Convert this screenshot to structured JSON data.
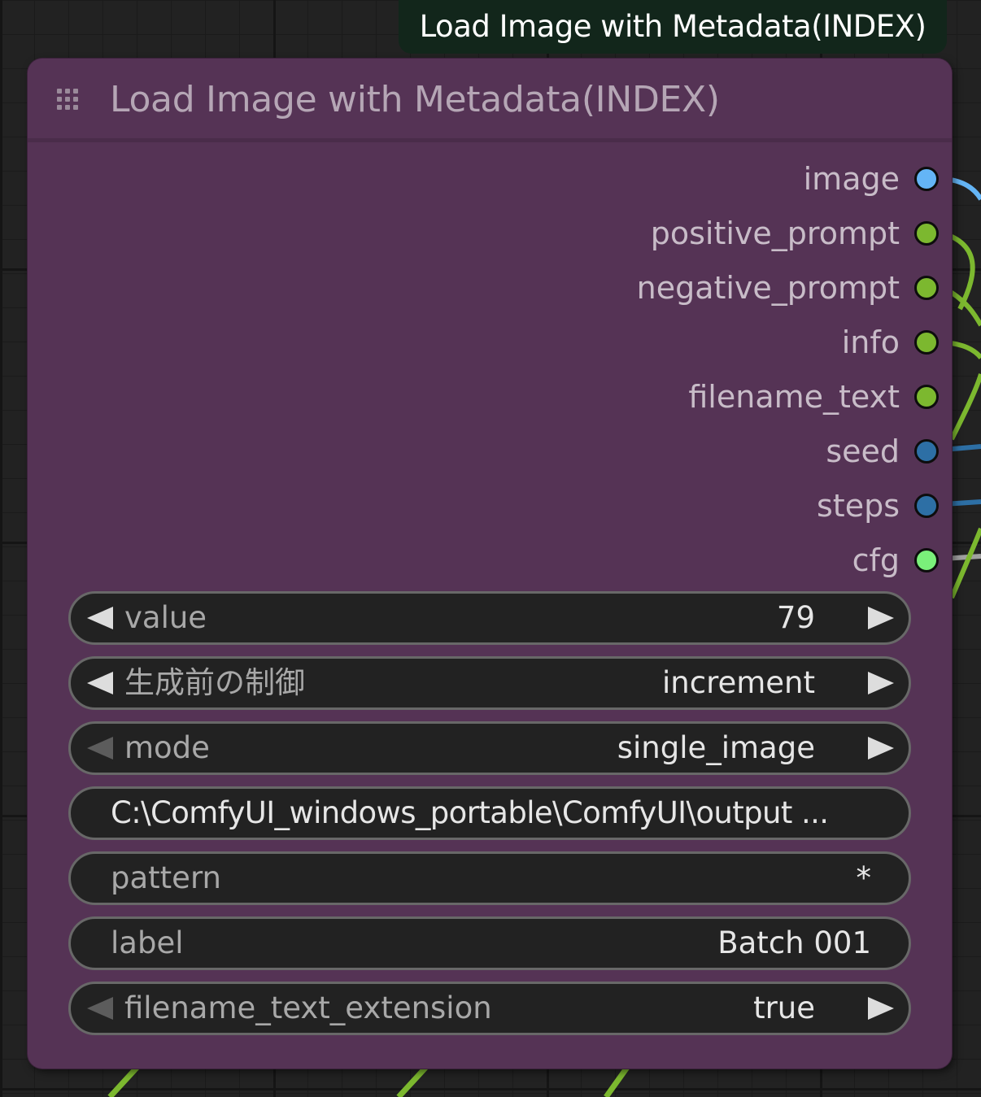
{
  "tooltip": {
    "text": "Load Image with Metadata(INDEX)"
  },
  "node": {
    "title": "Load Image with Metadata(INDEX)",
    "bg_color": "#553355",
    "outputs": [
      {
        "label": "image",
        "color": "#64b5f6"
      },
      {
        "label": "positive_prompt",
        "color": "#7cb82f"
      },
      {
        "label": "negative_prompt",
        "color": "#7cb82f"
      },
      {
        "label": "info",
        "color": "#7cb82f"
      },
      {
        "label": "filename_text",
        "color": "#7cb82f"
      },
      {
        "label": "seed",
        "color": "#2d6fa5"
      },
      {
        "label": "steps",
        "color": "#2d6fa5"
      },
      {
        "label": "cfg",
        "color": "#7af07a"
      }
    ],
    "widgets": {
      "value": {
        "label": "value",
        "value": "79"
      },
      "control": {
        "label": "生成前の制御",
        "value": "increment"
      },
      "mode": {
        "label": "mode",
        "value": "single_image"
      },
      "path": {
        "value": "C:\\ComfyUI_windows_portable\\ComfyUI\\output ..."
      },
      "pattern": {
        "label": "pattern",
        "value": "*"
      },
      "label": {
        "label": "label",
        "value": "Batch 001"
      },
      "extension": {
        "label": "filename_text_extension",
        "value": "true"
      }
    }
  },
  "colors": {
    "canvas": "#222222",
    "string_wire": "#7cb82f",
    "image_wire": "#64b5f6",
    "int_wire": "#2d6fa5",
    "float_wire": "#a0a0a0"
  }
}
